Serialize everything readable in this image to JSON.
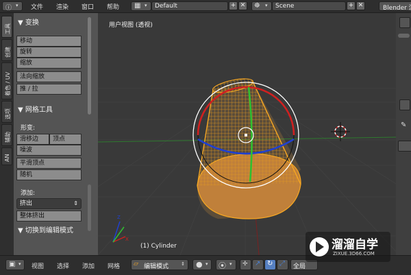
{
  "header": {
    "menus": [
      "文件",
      "渲染",
      "窗口",
      "帮助"
    ],
    "layout_value": "Default",
    "scene_value": "Scene",
    "app_label": "Blender 渲"
  },
  "tabs": [
    "工具",
    "创建",
    "着色 / UV",
    "选项",
    "辅助",
    "AN"
  ],
  "toolshelf": {
    "transform_header": "▼ 变换",
    "transform_buttons": [
      "移动",
      "旋转",
      "缩放",
      "法向缩放",
      "推 / 拉"
    ],
    "mesh_tools_header": "▼ 网格工具",
    "deform_label": "形变:",
    "slide_edge": "滑移边",
    "vertex": "顶点",
    "deform_buttons": [
      "噪波",
      "平滑顶点",
      "随机"
    ],
    "add_label": "添加:",
    "extrude": "挤出",
    "extrude_region": "整体挤出",
    "toggle_edit_header": "▼ 切换到编辑模式"
  },
  "viewport": {
    "title": "用户视图 (透视)",
    "object_name": "(1) Cylinder"
  },
  "bottom": {
    "menus": [
      "视图",
      "选择",
      "添加",
      "网格"
    ],
    "mode": "编辑模式",
    "global_label": "全局"
  },
  "watermark": {
    "title": "溜溜自学",
    "subtitle": "ZIXUE.3D66.COM"
  },
  "colors": {
    "accent_orange": "#f5a623",
    "axis_red": "#d02020",
    "axis_green": "#30c030",
    "axis_blue": "#2040d0"
  }
}
